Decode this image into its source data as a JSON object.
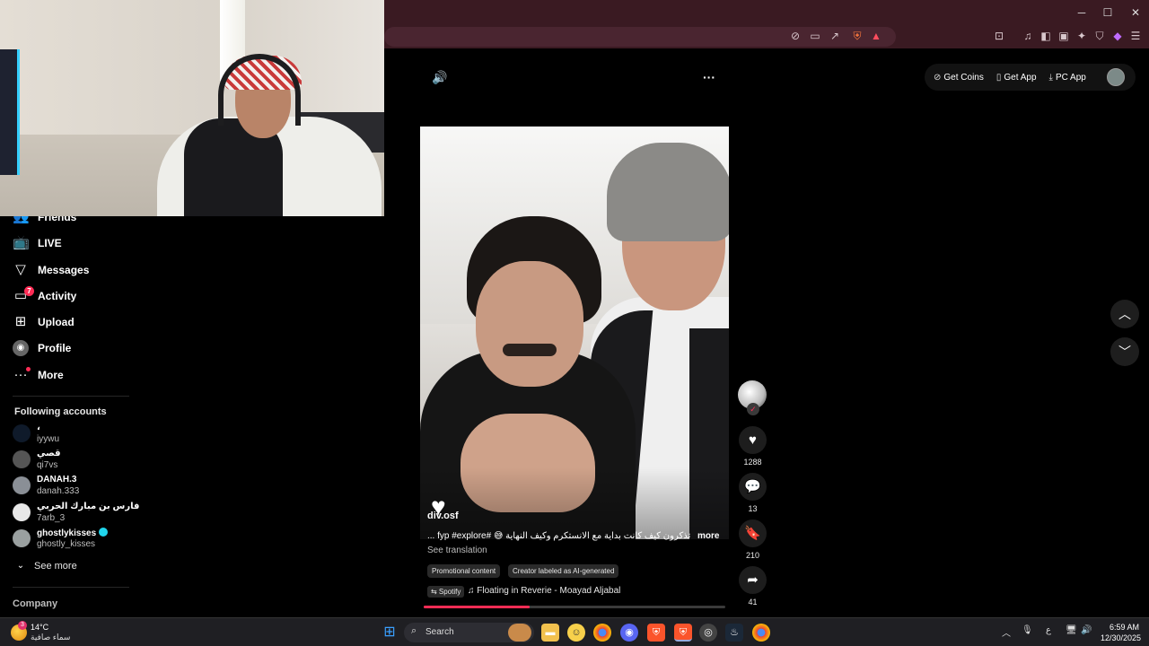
{
  "window": {
    "minimize": "─",
    "maximize": "☐",
    "close": "✕"
  },
  "sidebar": {
    "items": [
      {
        "label": "Friends",
        "icon": "friends-icon",
        "glyph": "👥"
      },
      {
        "label": "LIVE",
        "icon": "live-tv-icon",
        "glyph": "📺"
      },
      {
        "label": "Messages",
        "icon": "paper-plane-icon",
        "glyph": "▽"
      },
      {
        "label": "Activity",
        "icon": "activity-message-icon",
        "glyph": "▭",
        "badge": "7"
      },
      {
        "label": "Upload",
        "icon": "upload-plus-icon",
        "glyph": "⊞"
      },
      {
        "label": "Profile",
        "icon": "profile-avatar-icon",
        "glyph": "◉"
      },
      {
        "label": "More",
        "icon": "more-dots-icon",
        "glyph": "···"
      }
    ],
    "following_heading": "Following accounts",
    "accounts": [
      {
        "name": "، ",
        "username": "iyywu"
      },
      {
        "name": "قصي",
        "username": "qi7vs"
      },
      {
        "name": "DANAH.3",
        "username": "danah.333"
      },
      {
        "name": "فارس بن مبارك الحربي",
        "username": "7arb_3"
      },
      {
        "name": "ghostlykisses",
        "username": "ghostly_kisses",
        "verified": true
      }
    ],
    "see_more": "See more",
    "company_heading": "Company"
  },
  "topbar": {
    "get_coins": "Get Coins",
    "get_app": "Get App",
    "pc_app": "PC App"
  },
  "video": {
    "author": "div.osf",
    "caption": "تذكرون كيف كانت بداية مع الانستكرم وكيف النهاية 😅 #fyp #explore ...",
    "more": "more",
    "see_translation": "See translation",
    "tags": [
      "Promotional content",
      "Creator labeled as AI-generated"
    ],
    "spotify": "⇆ Spotify",
    "music": "Floating in Reverie - Moayad Aljabal",
    "progress": 0.35
  },
  "actions": {
    "likes": "1288",
    "comments": "13",
    "saves": "210",
    "shares": "41"
  },
  "taskbar": {
    "temp": "14°C",
    "condition": "سماء صافية",
    "weather_badge": "3",
    "search_placeholder": "Search",
    "lang": "ع",
    "time": "6:59 AM",
    "date": "12/30/2025"
  },
  "colors": {
    "accent": "#fe2c55",
    "browser_frame": "#3a1a22",
    "verified": "#20d5ec"
  }
}
